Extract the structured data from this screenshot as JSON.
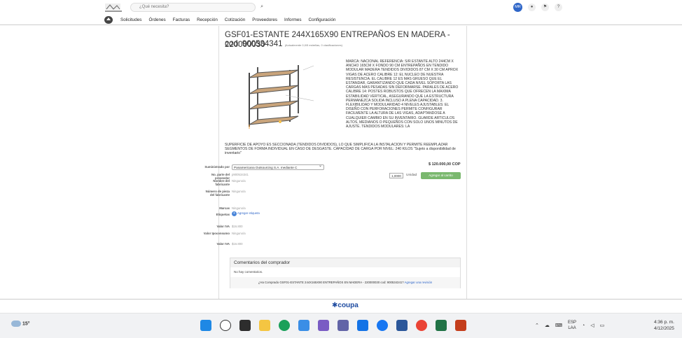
{
  "header": {
    "search_placeholder": "¿Qué necesita?",
    "user_initials": "MR",
    "nav": [
      "Solicitudes",
      "Órdenes",
      "Facturas",
      "Recepción",
      "Cotización",
      "Proveedores",
      "Informes",
      "Configuración"
    ]
  },
  "product": {
    "title": "GSF01-ESTANTE 244X165X90 ENTREPAÑOS EN MADERA - 220000030",
    "code": "cod: 900534341",
    "rating_note": "(Actualmente 0,0/5 estrellas, 0 clasificaciones)",
    "description_right": "MARCA: NACIONAL REFERENCIA: S/R ESTANTE ALTO 244CM X ANCHO 165CM X FONDO 90 CM ENTREPAÑOS EN TENDIDO MODULAR MADERA TENDIDOS DIVIDIDOS 87 CM X 30 CM APROX VIGAS DE ACERO CALIBRE 12: EL NUCLEO DE NUESTRA RESISTENCIA. EL CALIBRE 12 ES MAS GRUESO QUE EL ESTANDAR, GARANTIZANDO QUE CADA NIVEL SOPORTA LAS CARGAS MAS PESADAS SIN DEFORMARSE. PARALES DE ACERO CALIBRE 14: POSTES ROBUSTOS QUE OFRECEN LA MAXIMA ESTABILIDAD VERTICAL, ASEGURANDO QUE LA ESTRUCTURA PERMANEZCA SOLIDA INCLUSO A PLENA CAPACIDAD. 3. FLEXIBILIDAD Y MODULARIDAD 4 NIVELES AJUSTABLES: EL DISEÑO CON PERFORACIONES PERMITE CONFIGURAR FACILMENTE LA ALTURA DE LAS VIGAS, ADAPTANDOSE A CUALQUIER CAMBIO EN SU INVENTARIO. GUARDE ARTICULOS ALTOS, MEDIANOS O PEQUEÑOS CON SOLO UNOS MINUTOS DE AJUSTE. TENDIDOS MODULARES: LA",
    "description_bottom": "SUPERFICIE DE APOYO ES SECCIONADA (TENDIDOS DIVIDIDOS), LO QUE SIMPLIFICA LA INSTALACION Y PERMITE REEMPLAZAR SEGMENTOS DE FORMA INDIVIDUAL EN CASO DE DESGASTE. CAPACIDAD DE CARGA POR NIVEL: 240 KILOS \"Sujeto a disponibilidad de inventario\"",
    "supplier_label": "Suministrado por",
    "supplier_value": "Panamericana Outsourcing S.A. mediante C",
    "part_label": "No. parte del proveedor",
    "part_value": "p900534341",
    "manufacturer_label": "Nombre del fabricante",
    "manufacturer_value": "Ninguno/a",
    "mfr_part_label": "Número de pieza del fabricante",
    "mfr_part_value": "Ninguno/a",
    "brand_label": "Marcas",
    "brand_value": "Ninguno/a",
    "tags_label": "Etiquetas",
    "tags_value": "Agregar etiqueta",
    "vat1_label": "Valor IVA",
    "vat1_value": "$16.800",
    "vat2_label": "Valor Ipoconsumo",
    "vat2_value": "Ninguno/a",
    "vat3_label": "Valor IVA",
    "vat3_value": "$16.800",
    "price": "$ 120.000,00 COP",
    "qty": "1,0000",
    "unit": "Unidad",
    "add_button": "Agregar al carrito"
  },
  "comments": {
    "title": "Comentarios del comprador",
    "none": "No hay comentarios.",
    "prompt": "¿Ha Comprado GSF01-ESTANTE 244X165X90 ENTREPAÑOS EN MADERA - 220000030 cod: 900534341?",
    "link": "Agregar una revisión"
  },
  "footer": {
    "brand": "coupa"
  },
  "taskbar": {
    "temp": "15°",
    "lang1": "ESP",
    "lang2": "LAA",
    "time": "4:36 p. m.",
    "date": "4/12/2025"
  }
}
